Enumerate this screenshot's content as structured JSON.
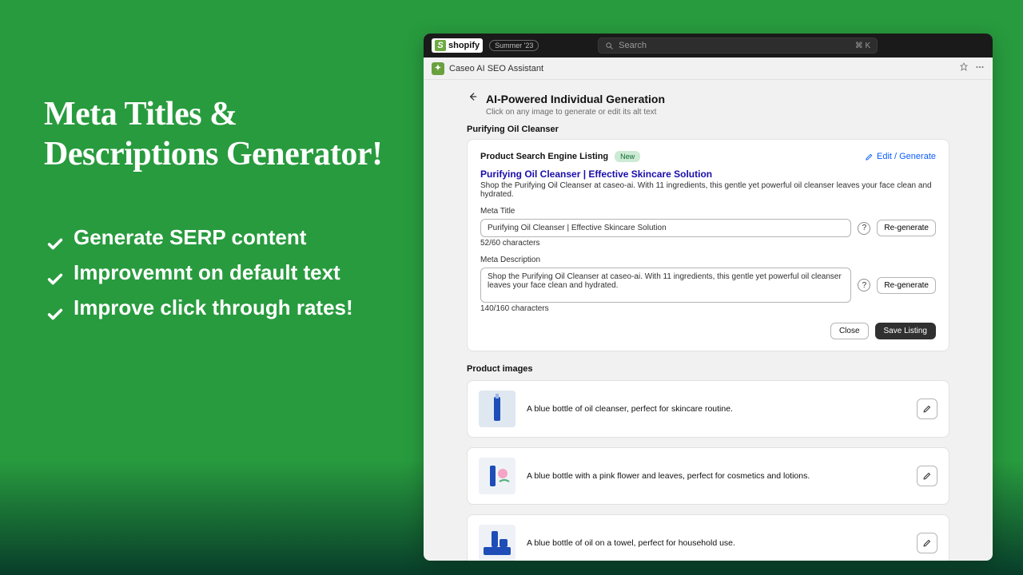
{
  "marketing": {
    "headline": "Meta Titles & Descriptions Generator!",
    "bullets": [
      "Generate SERP content",
      "Improvemnt on default text",
      "Improve click through rates!"
    ]
  },
  "topbar": {
    "brand": "shopify",
    "badge": "Summer '23",
    "search_placeholder": "Search",
    "shortcut": "⌘ K"
  },
  "app_header": {
    "name": "Caseo AI SEO Assistant"
  },
  "page": {
    "title": "AI-Powered Individual Generation",
    "subtitle": "Click on any image to generate or edit its alt text",
    "product_name": "Purifying Oil Cleanser"
  },
  "listing": {
    "section_label": "Product Search Engine Listing",
    "new_badge": "New",
    "edit_link": "Edit / Generate",
    "serp_title": "Purifying Oil Cleanser | Effective Skincare Solution",
    "serp_description": "Shop the Purifying Oil Cleanser at caseo-ai. With 11 ingredients, this gentle yet powerful oil cleanser leaves your face clean and hydrated.",
    "meta_title_label": "Meta Title",
    "meta_title_value": "Purifying Oil Cleanser | Effective Skincare Solution",
    "meta_title_counter": "52/60 characters",
    "meta_desc_label": "Meta Description",
    "meta_desc_value": "Shop the Purifying Oil Cleanser at caseo-ai. With 11 ingredients, this gentle yet powerful oil cleanser leaves your face clean and hydrated.",
    "meta_desc_counter": "140/160 characters",
    "regenerate": "Re-generate",
    "close": "Close",
    "save": "Save Listing"
  },
  "images_section": {
    "title": "Product images",
    "items": [
      {
        "alt": "A blue bottle of oil cleanser, perfect for skincare routine."
      },
      {
        "alt": "A blue bottle with a pink flower and leaves, perfect for cosmetics and lotions."
      },
      {
        "alt": "A blue bottle of oil on a towel, perfect for household use."
      }
    ]
  }
}
